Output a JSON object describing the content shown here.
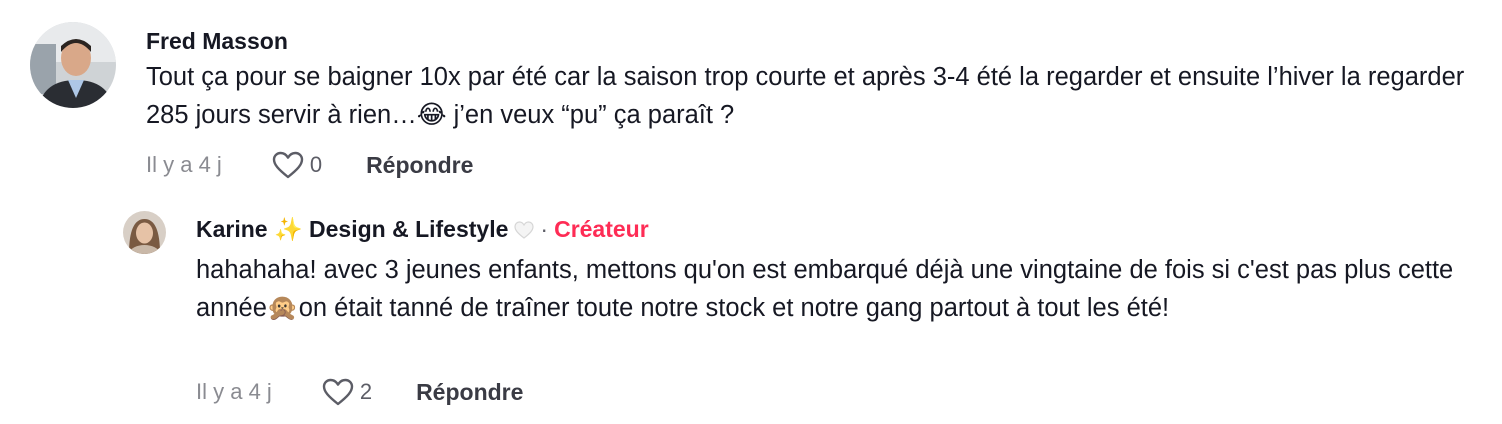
{
  "comments": [
    {
      "author": "Fred Masson",
      "text_before_emoji": "Tout ça pour se baigner 10x par été car la saison trop courte et après 3-4 été la regarder et ensuite l’hiver la regarder 285 jours servir à rien…",
      "emoji": "😂",
      "text_after_emoji": " j’en veux “pu” ça paraît ?",
      "time": "Il y a 4 j",
      "likes": "0",
      "reply_label": "Répondre"
    }
  ],
  "reply": {
    "author_name": "Karine",
    "author_sparkle": "✨",
    "author_rest": "Design & Lifestyle",
    "author_heart_icon": "white-heart-icon",
    "separator": "·",
    "creator_badge": "Créateur",
    "text_before_emoji": "hahahaha! avec 3 jeunes enfants, mettons qu'on est embarqué déjà une vingtaine de fois si c'est pas plus cette année",
    "emoji": "🙊",
    "text_after_emoji": "on était tanné de traîner toute notre stock et notre gang partout à tout les été!",
    "time": "Il y a 4 j",
    "likes": "2",
    "reply_label": "Répondre"
  },
  "colors": {
    "creator_badge": "#fe2c55",
    "muted_text": "#8a8b91",
    "primary_text": "#161823"
  },
  "icons": [
    "heart-outline-icon",
    "avatar"
  ]
}
